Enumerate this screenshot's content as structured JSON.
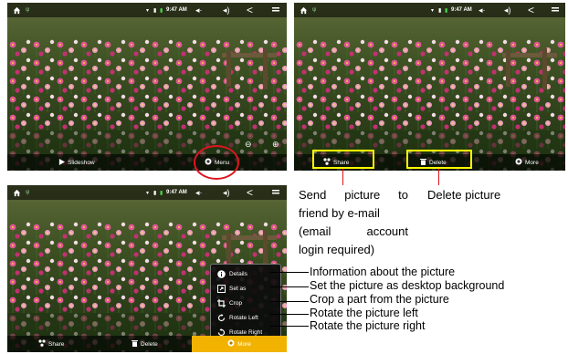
{
  "status_bar": {
    "time": "9:47 AM"
  },
  "screen1": {
    "bottom_bar": {
      "slideshow_label": "Slideshow",
      "menu_label": "Menu"
    }
  },
  "screen2": {
    "bottom_bar": {
      "share_label": "Share",
      "delete_label": "Delete",
      "more_label": "More"
    }
  },
  "screen3": {
    "bottom_bar": {
      "share_label": "Share",
      "delete_label": "Delete",
      "more_label": "More"
    },
    "more_menu": {
      "items": [
        {
          "label": "Details",
          "icon": "info-icon"
        },
        {
          "label": "Set as",
          "icon": "set-as-icon"
        },
        {
          "label": "Crop",
          "icon": "crop-icon"
        },
        {
          "label": "Rotate Left",
          "icon": "rotate-left-icon"
        },
        {
          "label": "Rotate Right",
          "icon": "rotate-right-icon"
        }
      ]
    }
  },
  "annotations": {
    "share_desc": [
      "Send picture to",
      "friend by e-mail",
      "(email account",
      "login required)"
    ],
    "delete_desc": "Delete picture",
    "menu_callouts": [
      "Information about the picture",
      "Set the picture as desktop background",
      "Crop a part from the picture",
      "Rotate the picture left",
      "Rotate the picture right"
    ]
  },
  "colors": {
    "highlight_red": "#e0141e",
    "highlight_yellow": "#ffff00",
    "more_active": "#f2b300"
  }
}
